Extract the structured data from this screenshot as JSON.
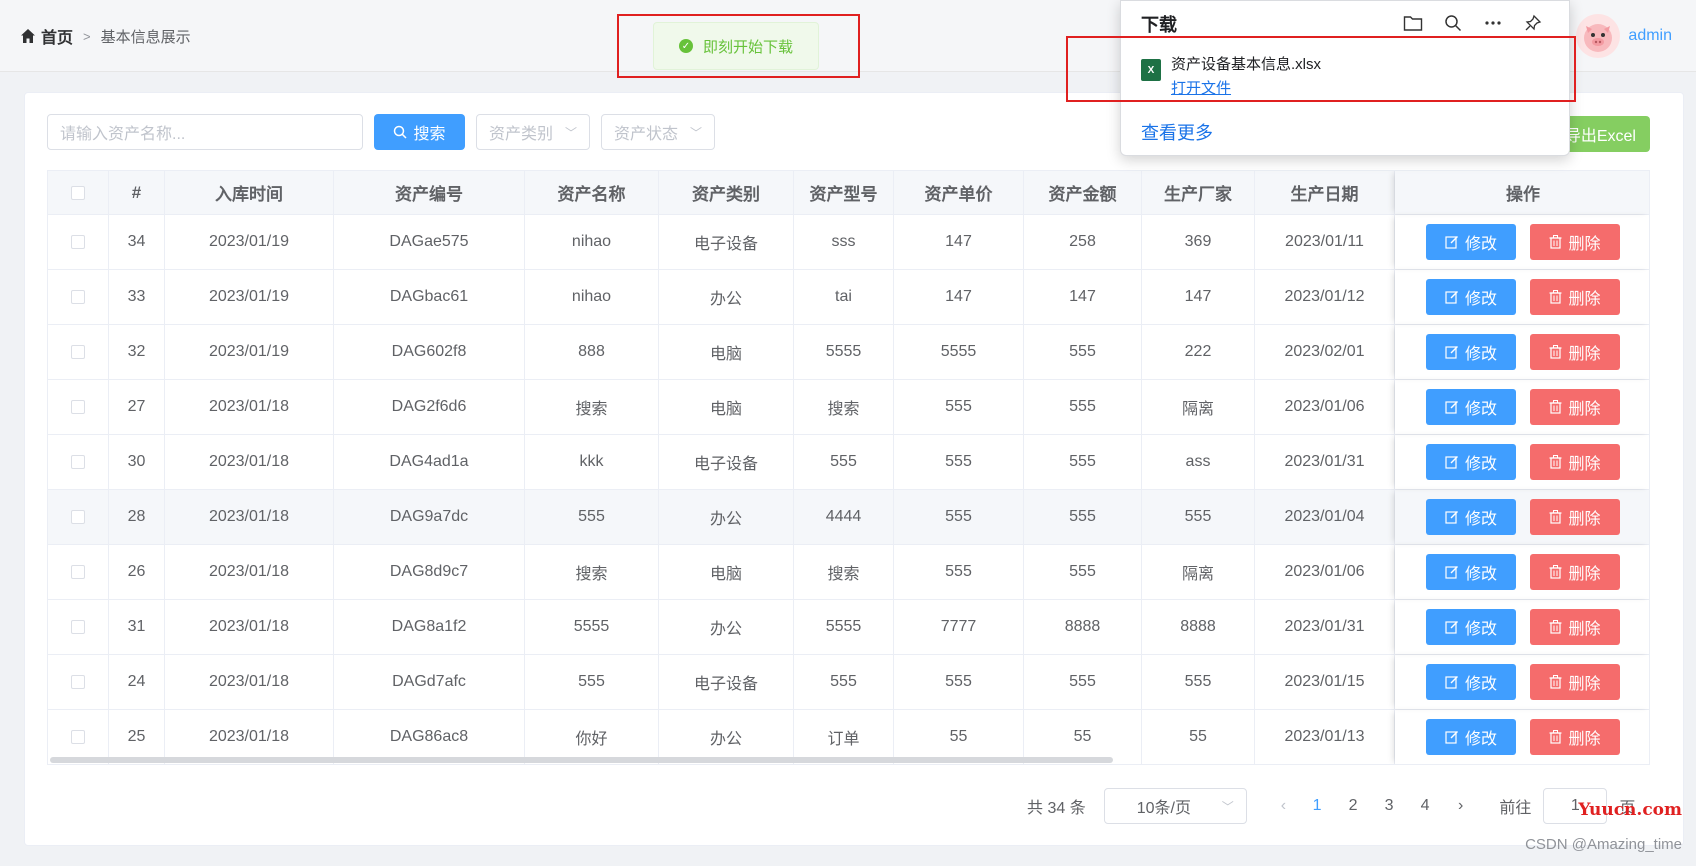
{
  "breadcrumb": {
    "home": "首页",
    "current": "基本信息展示"
  },
  "user": {
    "name": "admin"
  },
  "toast": {
    "text": "即刻开始下载"
  },
  "toolbar": {
    "search_placeholder": "请输入资产名称...",
    "search_button": "搜索",
    "category_select": "资产类别",
    "status_select": "资产状态",
    "export_button": "导出Excel"
  },
  "table": {
    "headers": [
      "#",
      "入库时间",
      "资产编号",
      "资产名称",
      "资产类别",
      "资产型号",
      "资产单价",
      "资产金额",
      "生产厂家",
      "生产日期",
      "操作"
    ],
    "edit_label": "修改",
    "delete_label": "删除",
    "rows": [
      [
        "34",
        "2023/01/19",
        "DAGae575",
        "nihao",
        "电子设备",
        "sss",
        "147",
        "258",
        "369",
        "2023/01/11"
      ],
      [
        "33",
        "2023/01/19",
        "DAGbac61",
        "nihao",
        "办公",
        "tai",
        "147",
        "147",
        "147",
        "2023/01/12"
      ],
      [
        "32",
        "2023/01/19",
        "DAG602f8",
        "888",
        "电脑",
        "5555",
        "5555",
        "555",
        "222",
        "2023/02/01"
      ],
      [
        "27",
        "2023/01/18",
        "DAG2f6d6",
        "搜索",
        "电脑",
        "搜索",
        "555",
        "555",
        "隔离",
        "2023/01/06"
      ],
      [
        "30",
        "2023/01/18",
        "DAG4ad1a",
        "kkk",
        "电子设备",
        "555",
        "555",
        "555",
        "ass",
        "2023/01/31"
      ],
      [
        "28",
        "2023/01/18",
        "DAG9a7dc",
        "555",
        "办公",
        "4444",
        "555",
        "555",
        "555",
        "2023/01/04"
      ],
      [
        "26",
        "2023/01/18",
        "DAG8d9c7",
        "搜索",
        "电脑",
        "搜索",
        "555",
        "555",
        "隔离",
        "2023/01/06"
      ],
      [
        "31",
        "2023/01/18",
        "DAG8a1f2",
        "5555",
        "办公",
        "5555",
        "7777",
        "8888",
        "8888",
        "2023/01/31"
      ],
      [
        "24",
        "2023/01/18",
        "DAGd7afc",
        "555",
        "电子设备",
        "555",
        "555",
        "555",
        "555",
        "2023/01/15"
      ],
      [
        "25",
        "2023/01/18",
        "DAG86ac8",
        "你好",
        "办公",
        "订单",
        "55",
        "55",
        "55",
        "2023/01/13"
      ]
    ]
  },
  "pager": {
    "total": "共 34 条",
    "page_size": "10条/页",
    "pages": [
      "1",
      "2",
      "3",
      "4"
    ],
    "goto_label": "前往",
    "goto_value": "1",
    "page_suffix": "页"
  },
  "download": {
    "title": "下载",
    "file_name": "资产设备基本信息.xlsx",
    "open_file": "打开文件",
    "see_more": "查看更多"
  },
  "watermark": {
    "site": "Yuucn.com",
    "author": "CSDN @Amazing_time"
  },
  "colors": {
    "primary": "#409eff",
    "danger": "#f56c6c",
    "success": "#85ce61",
    "annotation": "#e02020"
  }
}
